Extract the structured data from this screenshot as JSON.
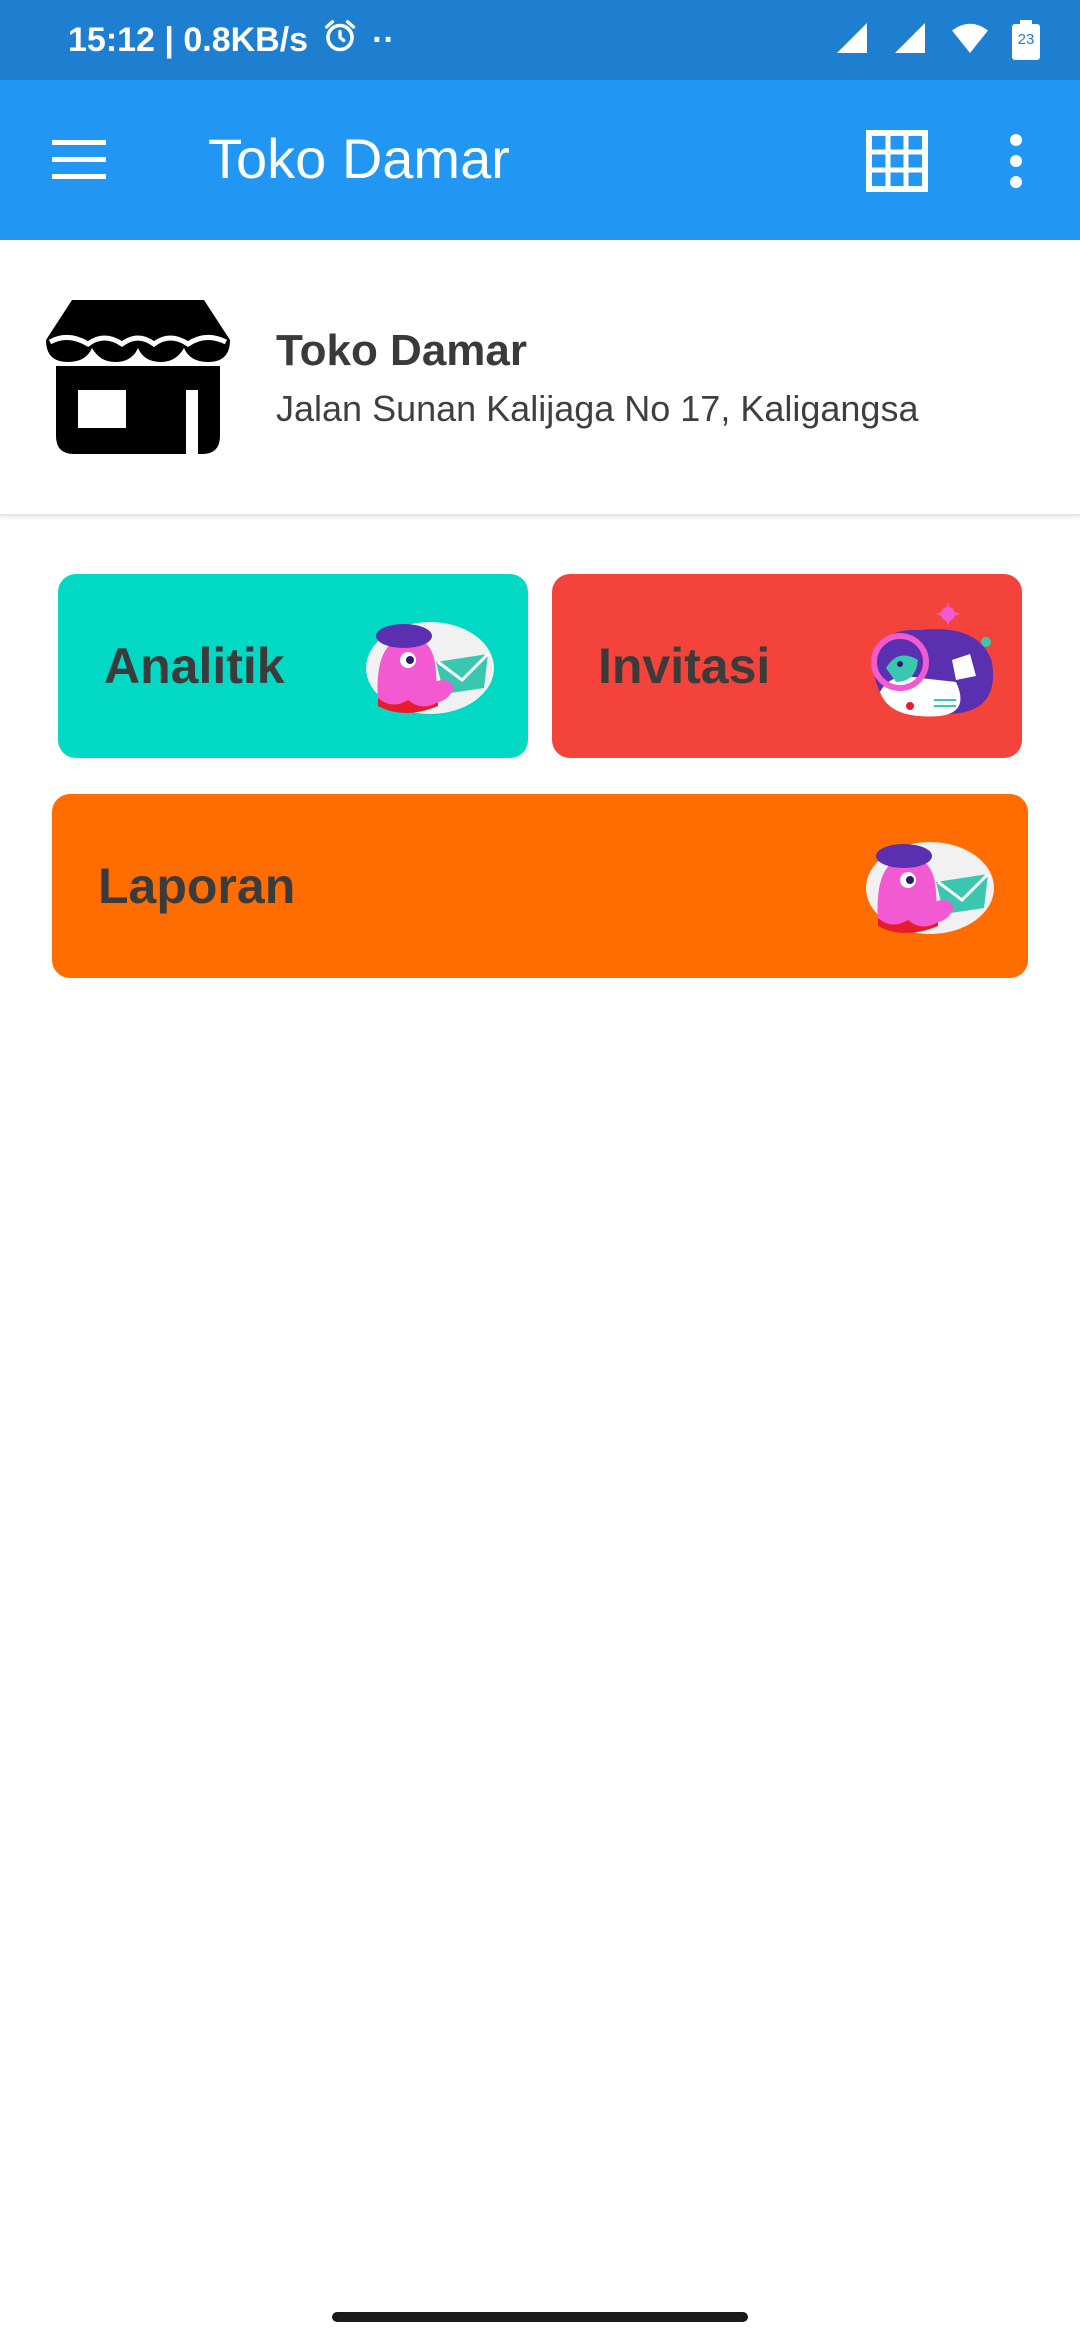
{
  "status_bar": {
    "time_speed": "15:12 | 0.8KB/s",
    "dots": "··",
    "battery_level": "23"
  },
  "app_bar": {
    "title": "Toko Damar"
  },
  "store": {
    "name": "Toko Damar",
    "address": "Jalan Sunan Kalijaga No 17, Kaligangsa"
  },
  "tiles": [
    {
      "label": "Analitik",
      "color": "#02d9c4"
    },
    {
      "label": "Invitasi",
      "color": "#f4433a"
    },
    {
      "label": "Laporan",
      "color": "#ff6d00"
    }
  ],
  "colors": {
    "app_bar": "#2196f3",
    "status_bar": "#1e7fd1"
  }
}
